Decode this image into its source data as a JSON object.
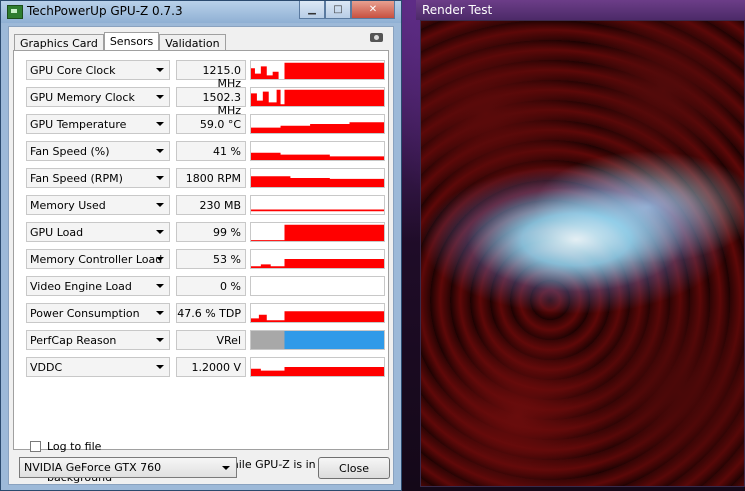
{
  "gpuz": {
    "title": "TechPowerUp GPU-Z 0.7.3",
    "tabs": [
      {
        "label": "Graphics Card"
      },
      {
        "label": "Sensors"
      },
      {
        "label": "Validation"
      }
    ],
    "sensors": [
      {
        "name": "GPU Core Clock",
        "value": "1215.0 MHz"
      },
      {
        "name": "GPU Memory Clock",
        "value": "1502.3 MHz"
      },
      {
        "name": "GPU Temperature",
        "value": "59.0 °C"
      },
      {
        "name": "Fan Speed (%)",
        "value": "41 %"
      },
      {
        "name": "Fan Speed (RPM)",
        "value": "1800 RPM"
      },
      {
        "name": "Memory Used",
        "value": "230 MB"
      },
      {
        "name": "GPU Load",
        "value": "99 %"
      },
      {
        "name": "Memory Controller Load",
        "value": "53 %"
      },
      {
        "name": "Video Engine Load",
        "value": "0 %"
      },
      {
        "name": "Power Consumption",
        "value": "47.6 % TDP"
      },
      {
        "name": "PerfCap Reason",
        "value": "VRel"
      },
      {
        "name": "VDDC",
        "value": "1.2000 V"
      }
    ],
    "log_to_file": {
      "label": "Log to file",
      "checked": false
    },
    "continue_refresh": {
      "label": "Continue refreshing this screen while GPU-Z is in the background",
      "checked": true
    },
    "gpu_select": "NVIDIA GeForce GTX 760",
    "close_label": "Close"
  },
  "render_test": {
    "title": "Render Test"
  },
  "colors": {
    "graph": "#ff0000",
    "perfcap_idle": "#a8a8a8",
    "perfcap_vrel": "#2f9ae8"
  }
}
